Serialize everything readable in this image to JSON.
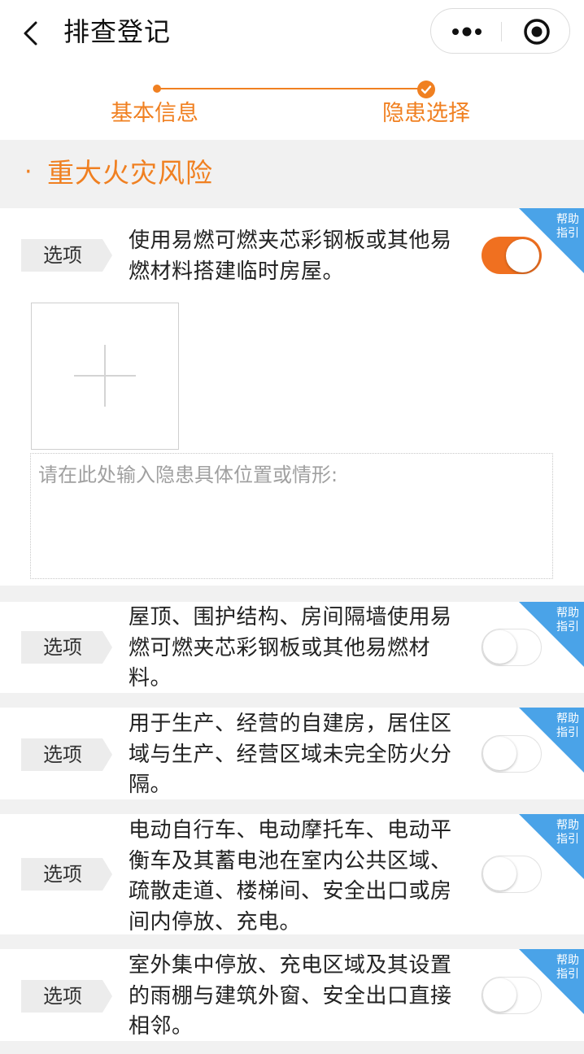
{
  "nav": {
    "title": "排查登记",
    "back_icon": "chevron-left-icon",
    "more_icon": "more-dots-icon",
    "close_icon": "target-circle-icon"
  },
  "steps": [
    {
      "label": "基本信息"
    },
    {
      "label": "隐患选择"
    }
  ],
  "section": {
    "title": "重大火灾风险"
  },
  "form": {
    "placeholder": "请在此处输入隐患具体位置或情形:",
    "upload_icon": "plus-icon"
  },
  "colors": {
    "accent": "#f08021",
    "help_badge": "#4aa3e8",
    "background_gray": "#f1f1f1"
  },
  "items": [
    {
      "tag": "选项",
      "text": "使用易燃可燃夹芯彩钢板或其他易燃材料搭建临时房屋。",
      "on": true,
      "help": "帮助指引"
    },
    {
      "tag": "选项",
      "text": "屋顶、围护结构、房间隔墙使用易燃可燃夹芯彩钢板或其他易燃材料。",
      "on": false,
      "help": "帮助指引"
    },
    {
      "tag": "选项",
      "text": "用于生产、经营的自建房，居住区域与生产、经营区域未完全防火分隔。",
      "on": false,
      "help": "帮助指引"
    },
    {
      "tag": "选项",
      "text": "电动自行车、电动摩托车、电动平衡车及其蓄电池在室内公共区域、疏散走道、楼梯间、安全出口或房间内停放、充电。",
      "on": false,
      "help": "帮助指引"
    },
    {
      "tag": "选项",
      "text": "室外集中停放、充电区域及其设置的雨棚与建筑外窗、安全出口直接相邻。",
      "on": false,
      "help": "帮助指引"
    }
  ]
}
